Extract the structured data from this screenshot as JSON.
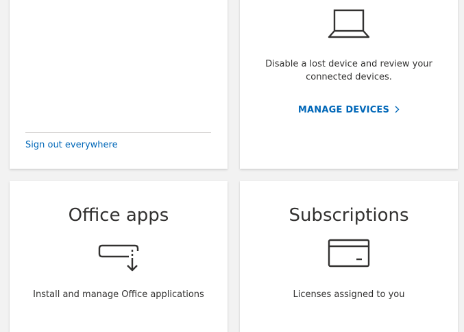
{
  "security_card": {
    "sign_out_link": "Sign out everywhere"
  },
  "devices_card": {
    "icon": "laptop-icon",
    "description_line1": "Disable a lost device and review your",
    "description_line2": "connected devices.",
    "manage_link": "MANAGE DEVICES"
  },
  "office_card": {
    "title": "Office apps",
    "icon": "install-download-icon",
    "description": "Install and manage Office applications"
  },
  "subscriptions_card": {
    "title": "Subscriptions",
    "icon": "credit-card-icon",
    "description": "Licenses assigned to you"
  },
  "colors": {
    "link": "#0067b8",
    "text": "#323130",
    "background": "#f2f2f2",
    "card": "#ffffff"
  }
}
